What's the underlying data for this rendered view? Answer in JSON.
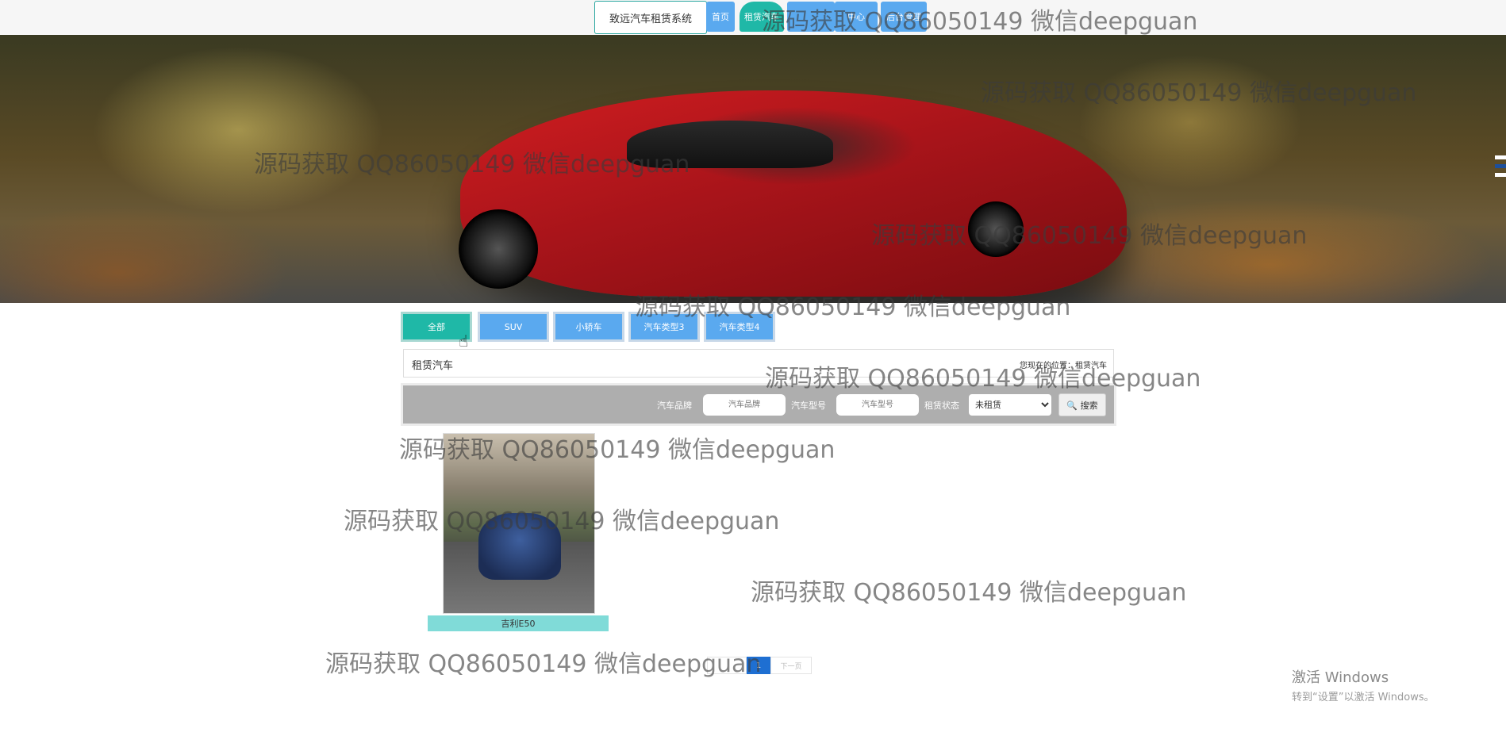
{
  "nav": {
    "brand": "致远汽车租赁系统",
    "items": [
      "首页",
      "租赁汽车",
      "中心",
      "后台管理"
    ]
  },
  "categories": [
    "全部",
    "SUV",
    "小轿车",
    "汽车类型3",
    "汽车类型4"
  ],
  "breadcrumb": {
    "title": "租赁汽车",
    "position": "您现在的位置：租赁汽车"
  },
  "filters": {
    "brand_label": "汽车品牌",
    "brand_placeholder": "汽车品牌",
    "model_label": "汽车型号",
    "model_placeholder": "汽车型号",
    "status_label": "租赁状态",
    "status_value": "未租赁",
    "search_label": "🔍 搜索"
  },
  "cars": [
    {
      "name": "吉利E50"
    }
  ],
  "pager": {
    "current": "1",
    "next": "下一页"
  },
  "watermark": "源码获取 QQ86050149 微信deepguan",
  "windows_activation": {
    "title": "激活 Windows",
    "subtitle": "转到“设置”以激活 Windows。"
  }
}
